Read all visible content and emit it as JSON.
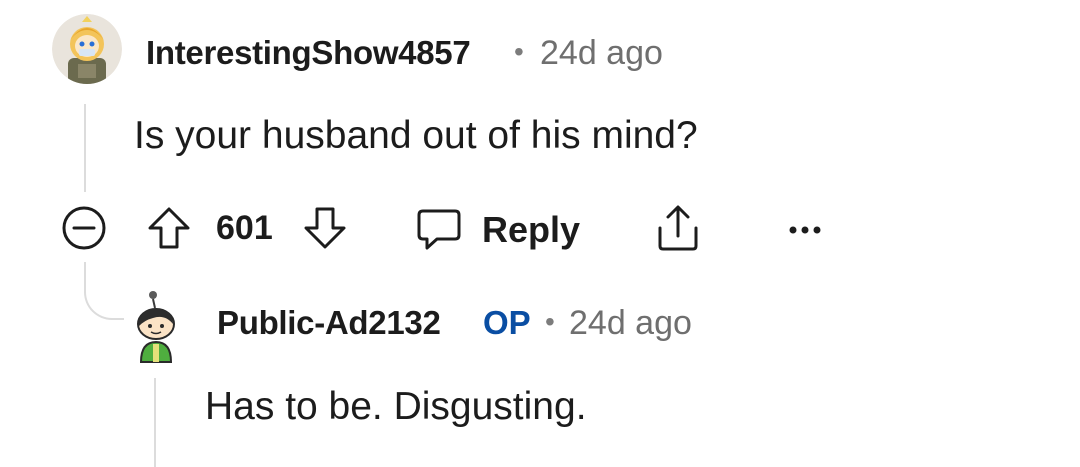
{
  "comment": {
    "author": "InterestingShow4857",
    "separator": "•",
    "time": "24d ago",
    "body": "Is your husband out of his mind?",
    "avatar_icon": "snoo-avatar-icon",
    "actions": {
      "collapse_icon": "collapse-minus-icon",
      "upvote_icon": "upvote-arrow-icon",
      "score": "601",
      "downvote_icon": "downvote-arrow-icon",
      "reply_icon": "speech-bubble-icon",
      "reply_label": "Reply",
      "share_icon": "share-icon",
      "more_icon": "more-dots-icon",
      "more_label": "•••"
    }
  },
  "reply": {
    "author": "Public-Ad2132",
    "badge": "OP",
    "separator": "•",
    "time": "24d ago",
    "body": "Has to be. Disgusting.",
    "avatar_icon": "snoo-avatar-icon"
  },
  "colors": {
    "text": "#1c1c1c",
    "meta": "#6f6f6f",
    "op_badge": "#0a4ea3",
    "thread_line": "#dcdcdc"
  }
}
